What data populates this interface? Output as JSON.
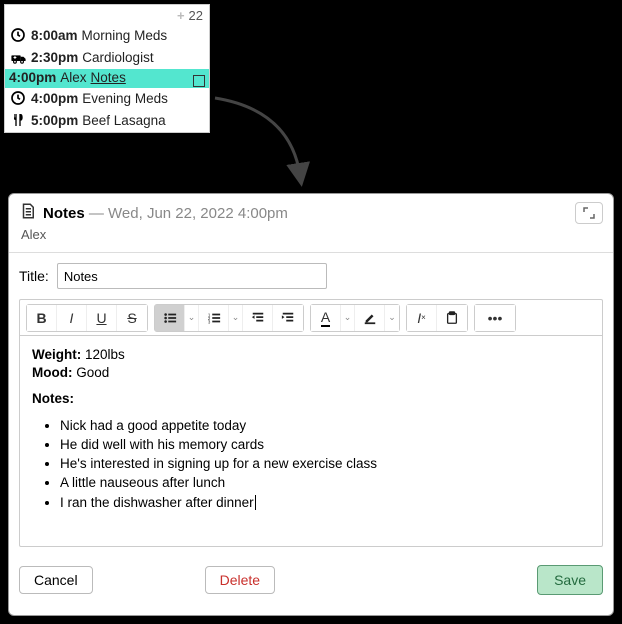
{
  "calendar": {
    "day_number": "22",
    "events": [
      {
        "icon": "clock",
        "time": "8:00am",
        "title": "Morning Meds",
        "highlight": false
      },
      {
        "icon": "ambulance",
        "time": "2:30pm",
        "title": "Cardiologist",
        "highlight": false
      },
      {
        "icon": "none",
        "time": "4:00pm",
        "title_prefix": "Alex",
        "title": "Notes",
        "highlight": true
      },
      {
        "icon": "clock",
        "time": "4:00pm",
        "title": "Evening Meds",
        "highlight": false
      },
      {
        "icon": "fork-knife",
        "time": "5:00pm",
        "title": "Beef Lasagna",
        "highlight": false
      }
    ]
  },
  "editor": {
    "header_icon": "document",
    "header_title": "Notes",
    "header_sep": " — ",
    "header_datetime": "Wed, Jun 22, 2022 4:00pm",
    "subheader": "Alex",
    "title_label": "Title:",
    "title_value": "Notes",
    "content": {
      "weight_label": "Weight:",
      "weight_value": "120lbs",
      "mood_label": "Mood:",
      "mood_value": "Good",
      "notes_heading": "Notes:",
      "bullets": [
        "Nick had a good appetite today",
        "He did well with his memory cards",
        "He's interested in signing up for a new exercise class",
        "A little nauseous after lunch",
        "I ran the dishwasher after dinner"
      ]
    },
    "buttons": {
      "cancel": "Cancel",
      "delete": "Delete",
      "save": "Save"
    }
  }
}
